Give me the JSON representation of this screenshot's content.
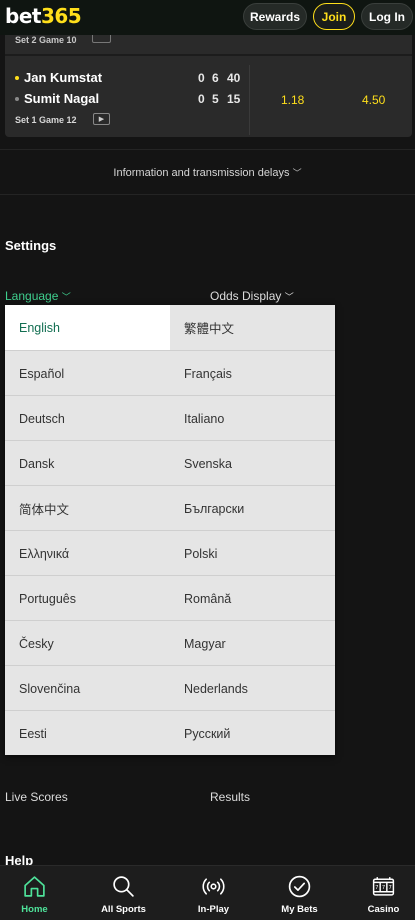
{
  "header": {
    "logo_white": "bet",
    "logo_yellow": "365",
    "rewards_label": "Rewards",
    "join_label": "Join",
    "login_label": "Log In"
  },
  "match": {
    "prev_row_label": "Set 2 Game 10",
    "players": [
      {
        "name": "Jan Kumstat",
        "set1": "0",
        "set2": "6",
        "points": "40",
        "serving": true
      },
      {
        "name": "Sumit Nagal",
        "set1": "0",
        "set2": "5",
        "points": "15",
        "serving": false
      }
    ],
    "set_info": "Set 1 Game 12",
    "odds": [
      "1.18",
      "4.50"
    ]
  },
  "info_delays": "Information and transmission delays",
  "settings": {
    "title": "Settings",
    "language_label": "Language",
    "odds_display_label": "Odds Display"
  },
  "languages": [
    [
      "English",
      "繁體中文"
    ],
    [
      "Español",
      "Français"
    ],
    [
      "Deutsch",
      "Italiano"
    ],
    [
      "Dansk",
      "Svenska"
    ],
    [
      "简体中文",
      "Български"
    ],
    [
      "Ελληνικά",
      "Polski"
    ],
    [
      "Português",
      "Română"
    ],
    [
      "Česky",
      "Magyar"
    ],
    [
      "Slovenčina",
      "Nederlands"
    ],
    [
      "Eesti",
      "Русский"
    ]
  ],
  "selected_language": "English",
  "links": {
    "live_scores": "Live Scores",
    "results": "Results"
  },
  "help_title": "Help",
  "nav": [
    {
      "label": "Home",
      "icon": "home-icon",
      "active": true
    },
    {
      "label": "All Sports",
      "icon": "search-icon",
      "active": false
    },
    {
      "label": "In-Play",
      "icon": "live-signal-icon",
      "active": false
    },
    {
      "label": "My Bets",
      "icon": "checkmark-circle-icon",
      "active": false
    },
    {
      "label": "Casino",
      "icon": "slot-machine-icon",
      "active": false
    }
  ],
  "colors": {
    "brand_yellow": "#ffdf1b",
    "brand_green": "#126e51",
    "active_green": "#4ee29a"
  }
}
